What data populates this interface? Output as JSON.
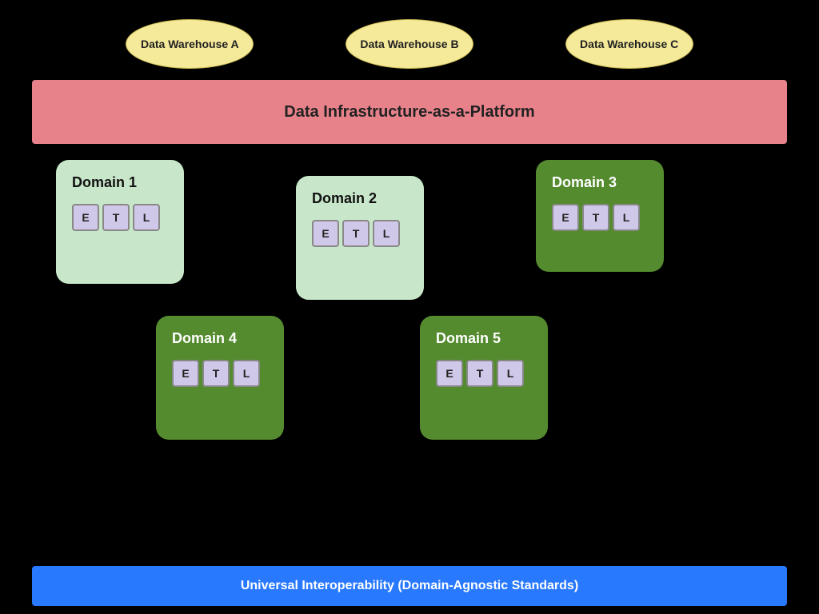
{
  "warehouses": [
    {
      "label": "Data Warehouse A"
    },
    {
      "label": "Data Warehouse B"
    },
    {
      "label": "Data Warehouse C"
    }
  ],
  "infrastructure": {
    "label": "Data Infrastructure-as-a-Platform"
  },
  "domains": [
    {
      "id": "domain1",
      "title": "Domain 1",
      "theme": "light-green",
      "etl": [
        "E",
        "T",
        "L"
      ]
    },
    {
      "id": "domain2",
      "title": "Domain 2",
      "theme": "light-green",
      "etl": [
        "E",
        "T",
        "L"
      ]
    },
    {
      "id": "domain3",
      "title": "Domain 3",
      "theme": "dark-green",
      "etl": [
        "E",
        "T",
        "L"
      ]
    },
    {
      "id": "domain4",
      "title": "Domain 4",
      "theme": "dark-green",
      "etl": [
        "E",
        "T",
        "L"
      ]
    },
    {
      "id": "domain5",
      "title": "Domain 5",
      "theme": "dark-green",
      "etl": [
        "E",
        "T",
        "L"
      ]
    }
  ],
  "bottom_bar": {
    "label": "Universal Interoperability (Domain-Agnostic Standards)"
  }
}
